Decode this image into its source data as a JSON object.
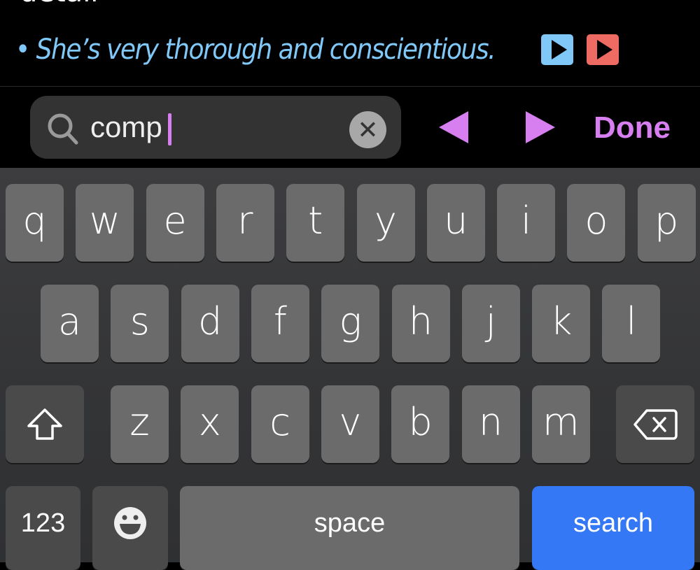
{
  "content": {
    "cut_text": "detail",
    "bullet": "•",
    "sentence": "She’s very thorough and conscientious.",
    "play_buttons": [
      {
        "icon": "play-icon",
        "color": "#7fc8f8"
      },
      {
        "icon": "play-icon",
        "color": "#ee6b63"
      }
    ]
  },
  "find_bar": {
    "query": "comp",
    "search_icon": "search-icon",
    "clear_icon": "clear-icon",
    "prev_icon": "previous-triangle-icon",
    "next_icon": "next-triangle-icon",
    "done_label": "Done",
    "accent": "#d77ff0"
  },
  "keyboard": {
    "row1": [
      "q",
      "w",
      "e",
      "r",
      "t",
      "y",
      "u",
      "i",
      "o",
      "p"
    ],
    "row2": [
      "a",
      "s",
      "d",
      "f",
      "g",
      "h",
      "j",
      "k",
      "l"
    ],
    "row3": [
      "z",
      "x",
      "c",
      "v",
      "b",
      "n",
      "m"
    ],
    "shift_icon": "shift-icon",
    "delete_icon": "delete-icon",
    "emoji_icon": "emoji-icon",
    "numbers_label": "123",
    "space_label": "space",
    "search_label": "search",
    "search_color": "#3478f6"
  }
}
